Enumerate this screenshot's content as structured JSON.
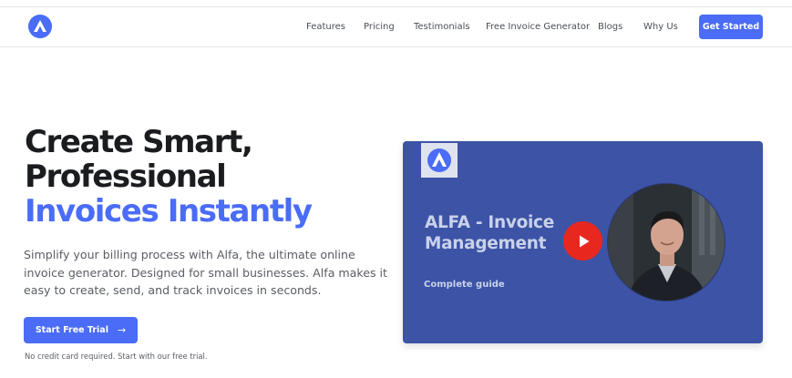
{
  "nav": {
    "logo_icon": "alfa-logo-icon",
    "links": {
      "features": "Features",
      "pricing": "Pricing",
      "testimonials": "Testimonials",
      "generator": "Free Invoice Generator",
      "blogs": "Blogs",
      "whyus": "Why Us"
    },
    "cta": "Get Started"
  },
  "hero": {
    "title_line1": "Create Smart,",
    "title_line2": "Professional",
    "title_accent": "Invoices Instantly",
    "description": "Simplify your billing process with Alfa, the ultimate online invoice generator. Designed for small businesses. Alfa makes it easy to create, send, and track invoices in seconds.",
    "trial_button": "Start Free Trial",
    "trial_arrow": "→",
    "trial_note": "No credit card required. Start with our free trial."
  },
  "video": {
    "title_line1": "ALFA - Invoice",
    "title_line2": "Management",
    "subtitle": "Complete guide",
    "play_icon": "play-icon"
  },
  "colors": {
    "brand": "#4a6cf7",
    "video_bg": "#3c53a6",
    "play_red": "#e8281f",
    "heading": "#1b1c20",
    "body_text": "#5a5d65"
  }
}
